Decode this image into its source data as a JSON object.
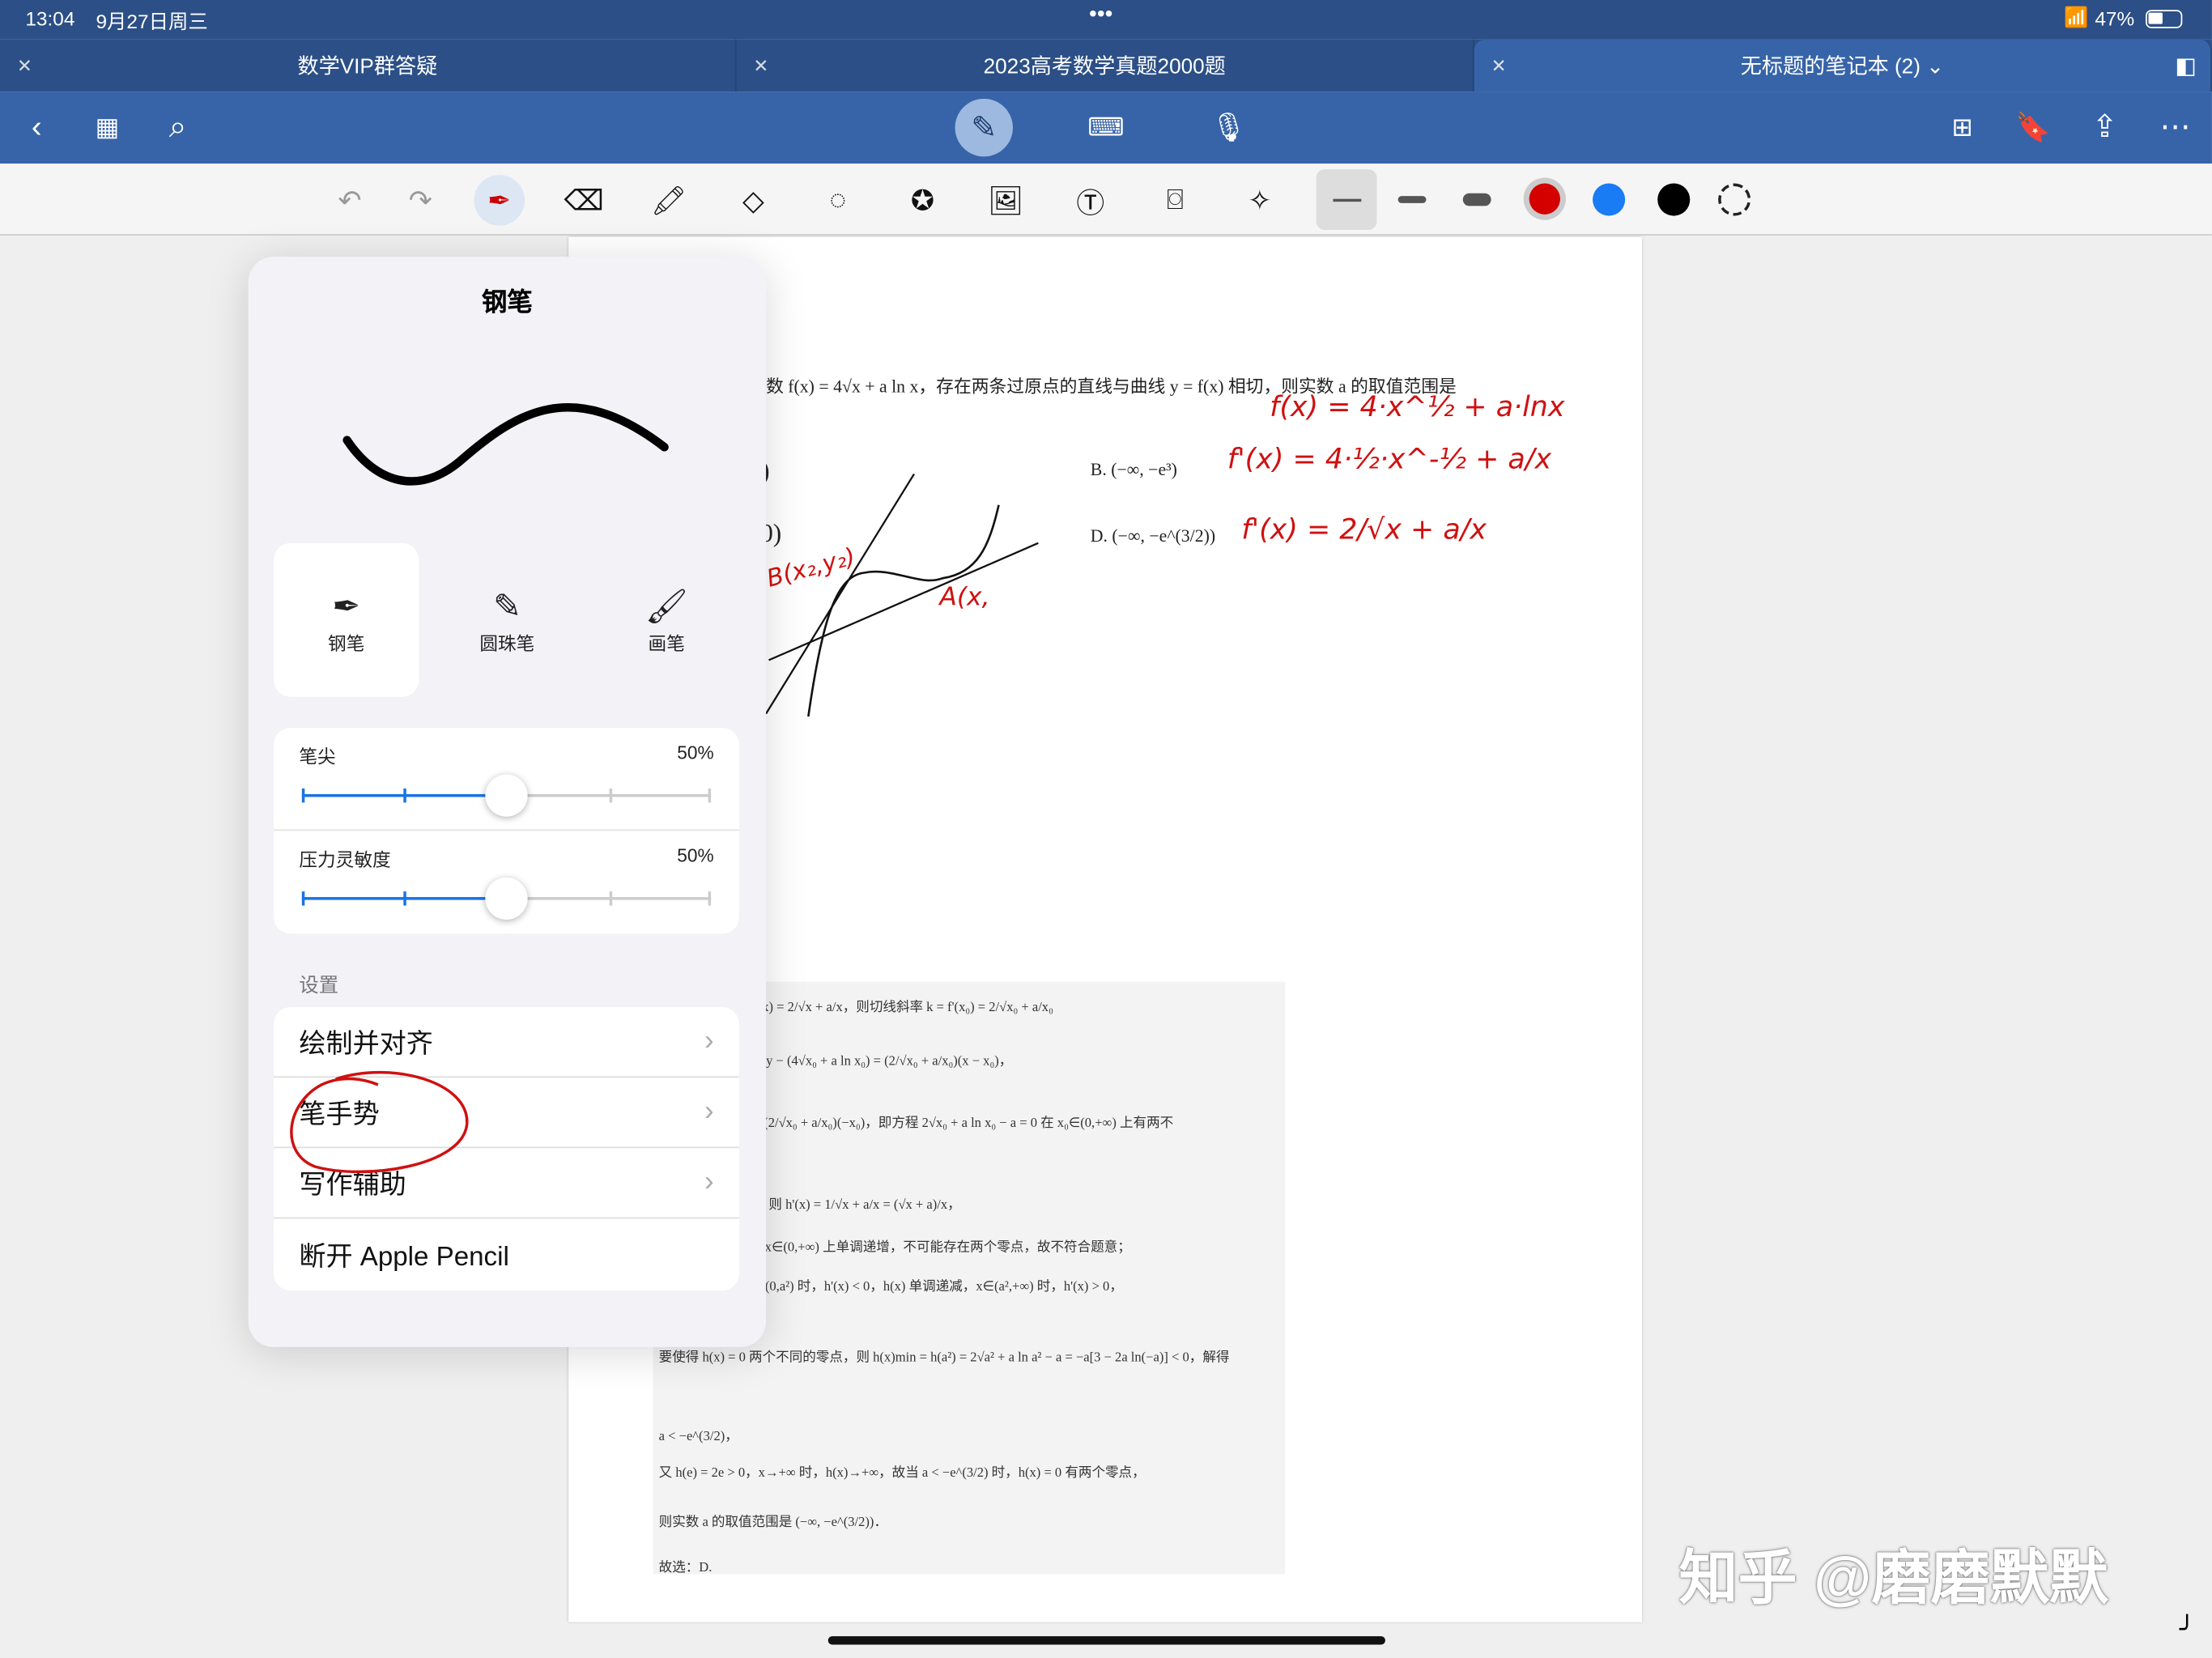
{
  "status": {
    "time": "13:04",
    "date": "9月27日周三",
    "battery": "47%"
  },
  "tabs": [
    {
      "label": "数学VIP群答疑"
    },
    {
      "label": "2023高考数学真题2000题"
    },
    {
      "label": "无标题的笔记本 (2) ⌄"
    }
  ],
  "drawbar": {
    "colors": [
      "#d40000",
      "#1a7cf5",
      "#000000"
    ],
    "selected_color": "#d40000"
  },
  "popover": {
    "title": "钢笔",
    "pens": [
      {
        "label": "钢笔",
        "selected": true
      },
      {
        "label": "圆珠笔"
      },
      {
        "label": "画笔"
      }
    ],
    "sliders": [
      {
        "label": "笔尖",
        "value": "50%",
        "fraction": 0.5
      },
      {
        "label": "压力灵敏度",
        "value": "50%",
        "fraction": 0.5
      }
    ],
    "section": "设置",
    "rows": [
      {
        "label": "绘制并对齐"
      },
      {
        "label": "笔手势"
      },
      {
        "label": "写作辅助"
      },
      {
        "label": "断开 Apple Pencil"
      }
    ]
  },
  "page": {
    "question": "数 f(x) = 4√x + a ln x，存在两条过原点的直线与曲线 y = f(x) 相切，则实数 a 的取值范围是",
    "opt_a": ")",
    "opt_c": "0)",
    "opt_b": "B.  (−∞, −e³)",
    "opt_d": "D.  (−∞, −e^(3/2))",
    "hw1": "f(x) = 4·x^½ + a·lnx",
    "hw2": "f'(x) = 4·½·x^-½ + a/x",
    "hw3": "f'(x) = 2/√x + a/x",
    "hwB": "B(x₂,y₂)",
    "hwA": "A(x,",
    "solution": [
      "标为(x₀,y₀)，又 f'(x) = 2/√x + a/x，则切线斜率 k = f'(x₀) = 2/√x₀ + a/x₀",
      "，则切线方程为：y − (4√x₀ + a ln x₀) = (2/√x₀ + a/x₀)(x − x₀)，",
      "−(4√x₀ + a ln x₀) = (2/√x₀ + a/x₀)(−x₀)，即方程 2√x₀ + a ln x₀ − a = 0 在 x₀∈(0,+∞) 上有两不",
      "x − a，x∈(0,+∞)，则 h'(x) = 1/√x + a/x = (√x + a)/x，",
      "0 恒成立，h(x) 在 x∈(0,+∞) 上单调递增，不可能存在两个零点，故不符合题意；",
      "0 得 x = a²，当 x∈(0,a²) 时，h'(x) < 0，h(x) 单调递减，x∈(a²,+∞) 时，h'(x) > 0，",
      "要使得 h(x) = 0 两个不同的零点，则 h(x)min = h(a²) = 2√a² + a ln a² − a = −a[3 − 2a ln(−a)] < 0，解得",
      "a < −e^(3/2)，",
      "又 h(e) = 2e > 0，x→+∞ 时，h(x)→+∞，故当 a < −e^(3/2) 时，h(x) = 0 有两个零点，",
      "则实数 a 的取值范围是 (−∞, −e^(3/2))．",
      "故选：D."
    ]
  },
  "watermark": "知乎 @磨磨默默"
}
